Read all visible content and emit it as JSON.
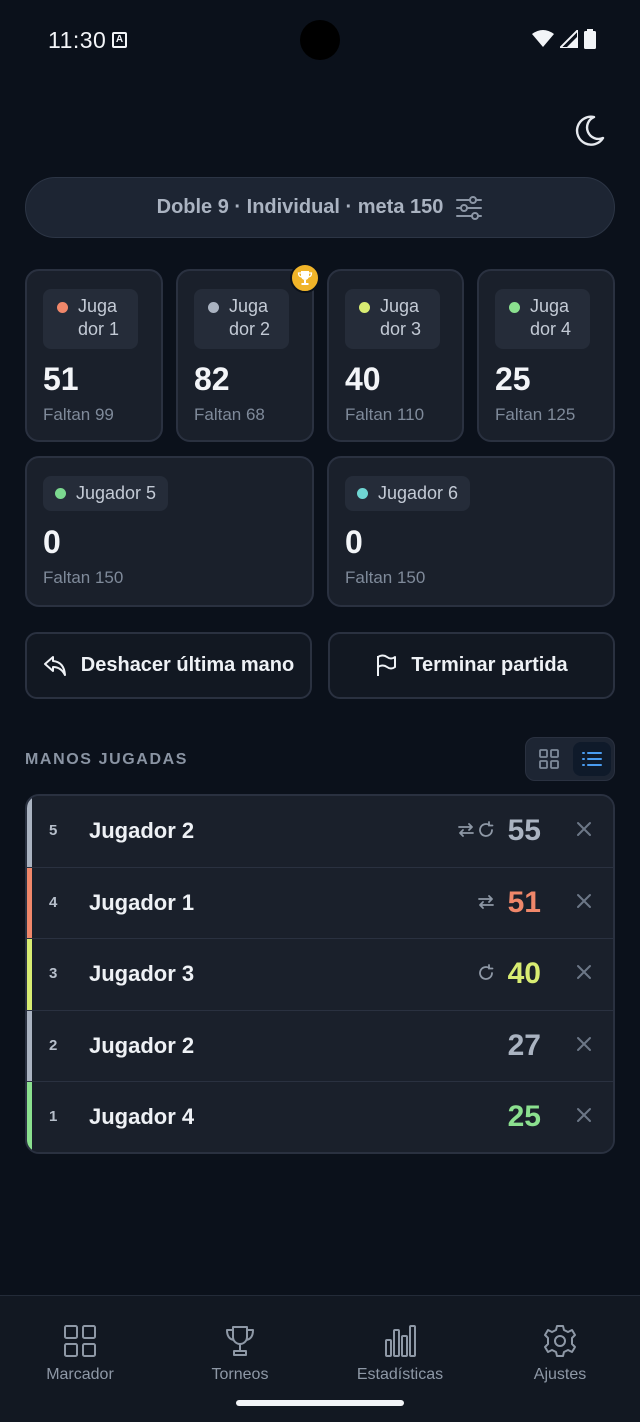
{
  "status": {
    "time": "11:30",
    "a_icon": "A"
  },
  "theme_toggle": {
    "icon": "moon-icon"
  },
  "config": {
    "summary": "Doble 9 · Individual · meta 150",
    "icon": "sliders-icon"
  },
  "players": [
    {
      "name": "Juga dor 1",
      "score": "51",
      "remaining": "Faltan 99",
      "color": "#f0876a"
    },
    {
      "name": "Juga dor 2",
      "score": "82",
      "remaining": "Faltan 68",
      "color": "#aab3c1",
      "leader": true
    },
    {
      "name": "Juga dor 3",
      "score": "40",
      "remaining": "Faltan 110",
      "color": "#d8ec72"
    },
    {
      "name": "Juga dor 4",
      "score": "25",
      "remaining": "Faltan 125",
      "color": "#8be08f"
    },
    {
      "name": "Jugador 5",
      "score": "0",
      "remaining": "Faltan 150",
      "color": "#7bd88f"
    },
    {
      "name": "Jugador 6",
      "score": "0",
      "remaining": "Faltan 150",
      "color": "#6fd6d3"
    }
  ],
  "actions": {
    "undo": "Deshacer última mano",
    "finish": "Terminar partida"
  },
  "hands_section": {
    "title": "MANOS JUGADAS",
    "active_view": "list"
  },
  "hands": [
    {
      "index": "5",
      "player": "Jugador 2",
      "points": "55",
      "color": "#aab3c1",
      "flags": [
        "swap-icon",
        "refresh-icon"
      ]
    },
    {
      "index": "4",
      "player": "Jugador 1",
      "points": "51",
      "color": "#f0876a",
      "flags": [
        "swap-icon"
      ]
    },
    {
      "index": "3",
      "player": "Jugador 3",
      "points": "40",
      "color": "#d8ec72",
      "flags": [
        "refresh-icon"
      ]
    },
    {
      "index": "2",
      "player": "Jugador 2",
      "points": "27",
      "color": "#aab3c1",
      "flags": []
    },
    {
      "index": "1",
      "player": "Jugador 4",
      "points": "25",
      "color": "#8be08f",
      "flags": []
    }
  ],
  "nav": [
    {
      "label": "Marcador",
      "icon": "grid-icon"
    },
    {
      "label": "Torneos",
      "icon": "trophy-icon"
    },
    {
      "label": "Estadísticas",
      "icon": "bar-chart-icon"
    },
    {
      "label": "Ajustes",
      "icon": "gear-icon"
    }
  ]
}
